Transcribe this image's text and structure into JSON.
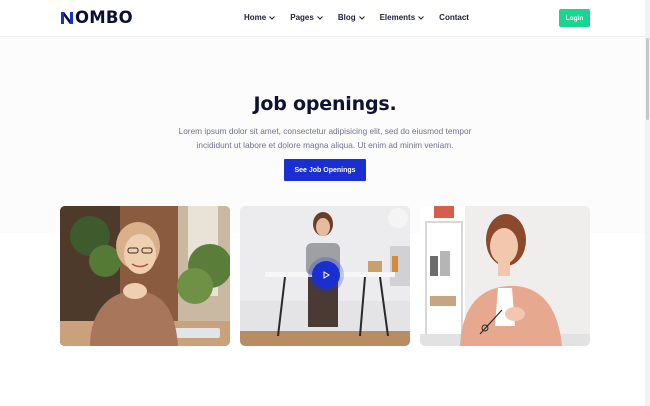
{
  "brand": {
    "logo_text": "OMBO",
    "logo_icon": "n-letter-icon",
    "accent": "#1a2fd1"
  },
  "nav": {
    "items": [
      {
        "label": "Home",
        "has_dropdown": true
      },
      {
        "label": "Pages",
        "has_dropdown": true
      },
      {
        "label": "Blog",
        "has_dropdown": true
      },
      {
        "label": "Elements",
        "has_dropdown": true
      },
      {
        "label": "Contact",
        "has_dropdown": false
      }
    ],
    "login_label": "Login",
    "login_color": "#17d68f"
  },
  "hero": {
    "title": "Job openings.",
    "description": "Lorem ipsum dolor sit amet, consectetur adipisicing elit, sed do eiusmod tempor incididunt ut labore et dolore magna aliqua. Ut enim ad minim veniam.",
    "cta_label": "See Job Openings"
  },
  "gallery": {
    "photos": [
      {
        "subject": "smiling woman with glasses at desk"
      },
      {
        "subject": "woman seated at table in office",
        "play_icon": "play-icon"
      },
      {
        "subject": "woman in pink blazer holding glasses"
      }
    ]
  }
}
